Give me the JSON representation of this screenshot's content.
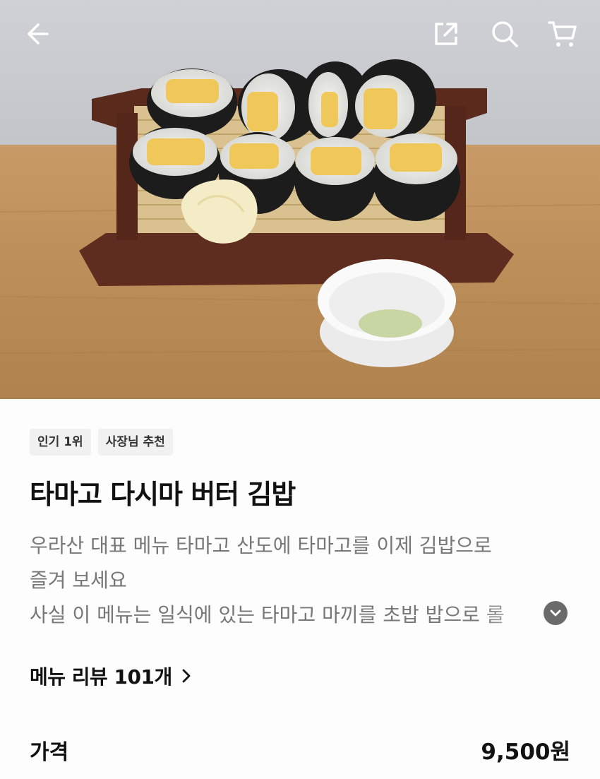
{
  "header": {
    "back_icon": "arrow-left-icon",
    "share_icon": "share-external-icon",
    "search_icon": "search-icon",
    "cart_icon": "cart-icon"
  },
  "product": {
    "tags": [
      "인기 1위",
      "사장님 추천"
    ],
    "title": "타마고 다시마 버터 김밥",
    "description_lines": [
      "우라산 대표 메뉴 타마고 산도에 타마고를 이제 김밥으로",
      "즐겨 보세요",
      "사실 이 메뉴는 일식에 있는 타마고 마끼를 초밥 밥으로 롤"
    ],
    "expand_icon": "chevron-down-icon"
  },
  "reviews": {
    "label": "메뉴 리뷰 101개",
    "icon": "chevron-right-icon"
  },
  "price": {
    "label": "가격",
    "value": "9,500원"
  },
  "colors": {
    "text": "#111111",
    "muted": "#777777",
    "tag_bg": "#f1f1f1",
    "wall": "#c9cbd0",
    "table": "#b98c58"
  }
}
